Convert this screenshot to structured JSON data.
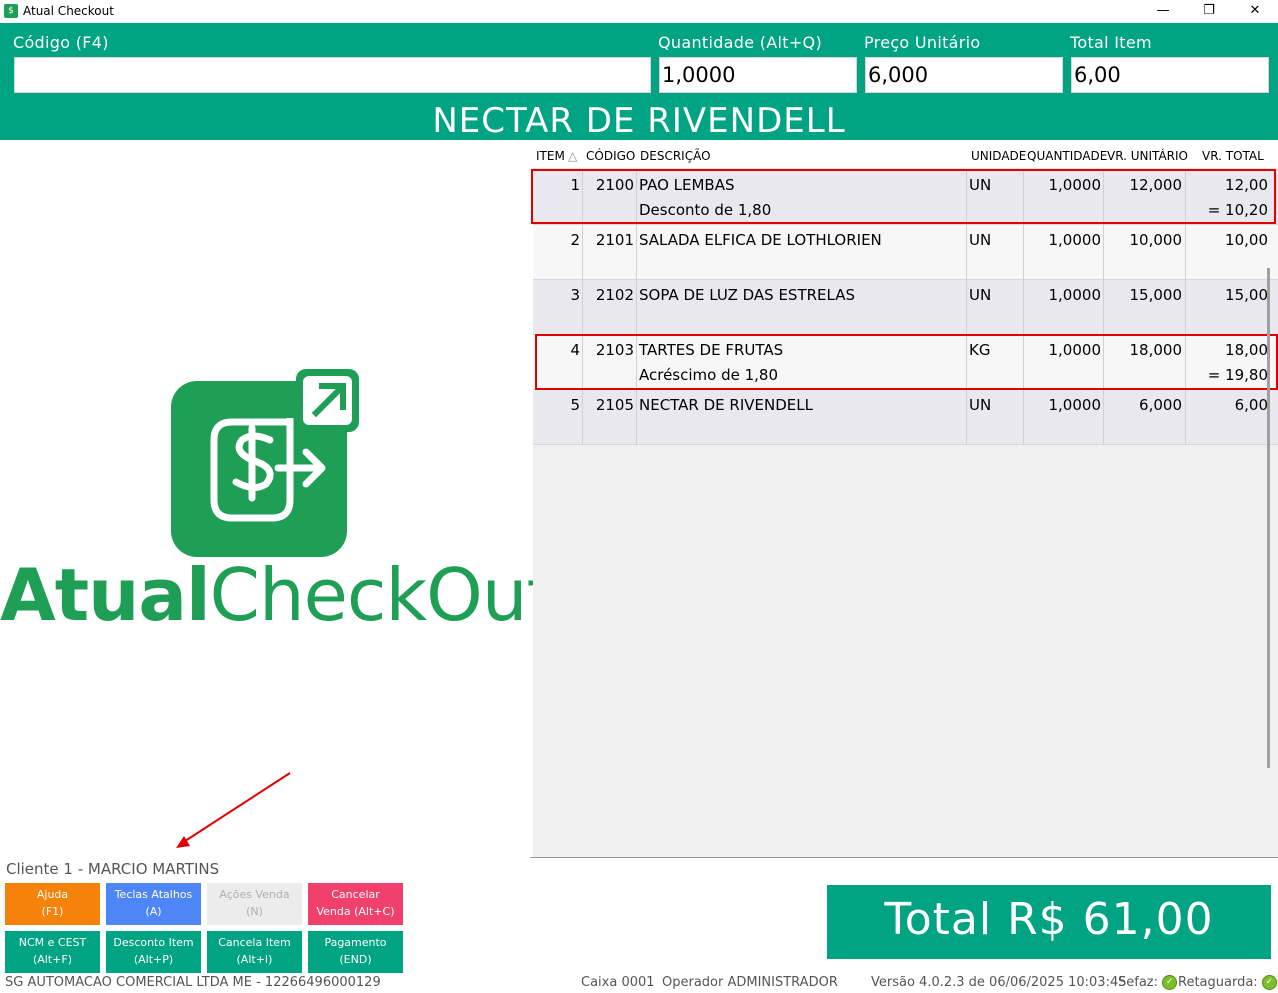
{
  "window": {
    "title": "Atual Checkout",
    "minimize": "—",
    "restore": "❐",
    "close": "✕"
  },
  "fields": {
    "codigo_label": "Código (F4)",
    "codigo_value": "",
    "quantidade_label": "Quantidade (Alt+Q)",
    "quantidade_value": "1,0000",
    "preco_label": "Preço Unitário",
    "preco_value": "6,000",
    "total_item_label": "Total Item",
    "total_item_value": "6,00"
  },
  "product_name": "NECTAR DE RIVENDELL",
  "logo": {
    "text_bold": "Atual",
    "text_light": "CheckOut",
    "color": "#1f9e55"
  },
  "grid": {
    "headers": {
      "item": "ITEM",
      "sort_icon": "△",
      "codigo": "CÓDIGO",
      "descricao": "DESCRIÇÃO",
      "unidade": "UNIDADE",
      "quantidade": "QUANTIDADE",
      "vr_unitario": "VR. UNITÁRIO",
      "vr_total": "VR. TOTAL"
    },
    "rows": [
      {
        "item": "1",
        "codigo": "2100",
        "descricao": "PAO LEMBAS",
        "sub": "Desconto de 1,80",
        "unidade": "UN",
        "quantidade": "1,0000",
        "vr_unitario": "12,000",
        "vr_total": "12,00",
        "vr_total_sub": "= 10,20"
      },
      {
        "item": "2",
        "codigo": "2101",
        "descricao": "SALADA ELFICA DE LOTHLORIEN",
        "sub": "",
        "unidade": "UN",
        "quantidade": "1,0000",
        "vr_unitario": "10,000",
        "vr_total": "10,00",
        "vr_total_sub": ""
      },
      {
        "item": "3",
        "codigo": "2102",
        "descricao": "SOPA DE LUZ DAS ESTRELAS",
        "sub": "",
        "unidade": "UN",
        "quantidade": "1,0000",
        "vr_unitario": "15,000",
        "vr_total": "15,00",
        "vr_total_sub": ""
      },
      {
        "item": "4",
        "codigo": "2103",
        "descricao": "TARTES DE FRUTAS",
        "sub": "Acréscimo de 1,80",
        "unidade": "KG",
        "quantidade": "1,0000",
        "vr_unitario": "18,000",
        "vr_total": "18,00",
        "vr_total_sub": "= 19,80"
      },
      {
        "item": "5",
        "codigo": "2105",
        "descricao": "NECTAR DE RIVENDELL",
        "sub": "",
        "unidade": "UN",
        "quantidade": "1,0000",
        "vr_unitario": "6,000",
        "vr_total": "6,00",
        "vr_total_sub": ""
      }
    ]
  },
  "client": "Cliente 1 - MARCIO MARTINS",
  "buttons": [
    {
      "line1": "Ajuda",
      "line2": "(F1)",
      "color": "#f5820a",
      "text_color": "#ffffff"
    },
    {
      "line1": "Teclas Atalhos",
      "line2": "(A)",
      "color": "#4f86f7",
      "text_color": "#ffffff"
    },
    {
      "line1": "Ações Venda",
      "line2": "(N)",
      "color": "#ececec",
      "text_color": "#b0b0b0"
    },
    {
      "line1": "Cancelar",
      "line2": "Venda (Alt+C)",
      "color": "#f0406c",
      "text_color": "#ffffff"
    },
    {
      "line1": "NCM e CEST",
      "line2": "(Alt+F)",
      "color": "#00a382",
      "text_color": "#ffffff"
    },
    {
      "line1": "Desconto Item",
      "line2": "(Alt+P)",
      "color": "#00a382",
      "text_color": "#ffffff"
    },
    {
      "line1": "Cancela Item",
      "line2": "(Alt+I)",
      "color": "#00a382",
      "text_color": "#ffffff"
    },
    {
      "line1": "Pagamento",
      "line2": "(END)",
      "color": "#00a382",
      "text_color": "#ffffff"
    }
  ],
  "total": "Total R$ 61,00",
  "status": {
    "company": "SG AUTOMACAO COMERCIAL LTDA ME - 12266496000129",
    "caixa": "Caixa 0001",
    "operador": "Operador ADMINISTRADOR",
    "versao": "Versão 4.0.2.3 de 06/06/2025 10:03:45",
    "sefaz": "Sefaz:",
    "retaguarda": "Retaguarda:",
    "check": "✓"
  },
  "colors": {
    "accent": "#00a382",
    "highlight": "#e00000"
  }
}
